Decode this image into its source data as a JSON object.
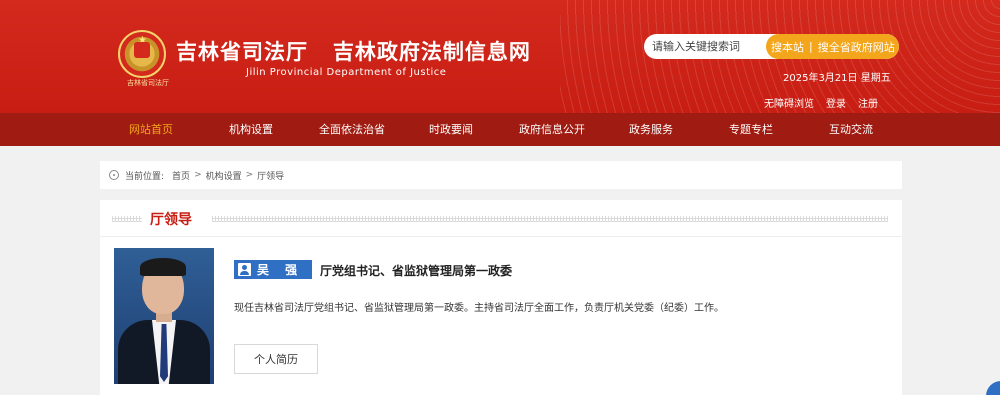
{
  "header": {
    "emblem_label": "吉林省司法厅",
    "title": "吉林省司法厅   吉林政府法制信息网",
    "subtitle": "Jilin Provincial Department of Justice",
    "search": {
      "placeholder": "请输入关键搜索词",
      "site_button": "搜本站",
      "separator": "|",
      "gov_button": "搜全省政府网站"
    },
    "date": "2025年3月21日 星期五",
    "links": [
      "无障碍浏览",
      "登录",
      "注册"
    ]
  },
  "nav": {
    "items": [
      {
        "label": "网站首页",
        "active": true
      },
      {
        "label": "机构设置"
      },
      {
        "label": "全面依法治省"
      },
      {
        "label": "时政要闻"
      },
      {
        "label": "政府信息公开"
      },
      {
        "label": "政务服务"
      },
      {
        "label": "专题专栏"
      },
      {
        "label": "互动交流"
      }
    ]
  },
  "breadcrumb": {
    "label": "当前位置:",
    "items": [
      "首页",
      "机构设置",
      "厅领导"
    ],
    "separator": ">"
  },
  "panel": {
    "title": "厅领导",
    "leader": {
      "name": "吴 强",
      "position": "厅党组书记、省监狱管理局第一政委",
      "description": "现任吉林省司法厅党组书记、省监狱管理局第一政委。主持省司法厅全面工作，负责厅机关党委（纪委）工作。",
      "resume_button": "个人简历"
    }
  },
  "colors": {
    "header_red": "#c81d12",
    "nav_dark_red": "#a01c12",
    "accent_orange": "#f3a51b",
    "badge_blue": "#2f6fc4"
  }
}
